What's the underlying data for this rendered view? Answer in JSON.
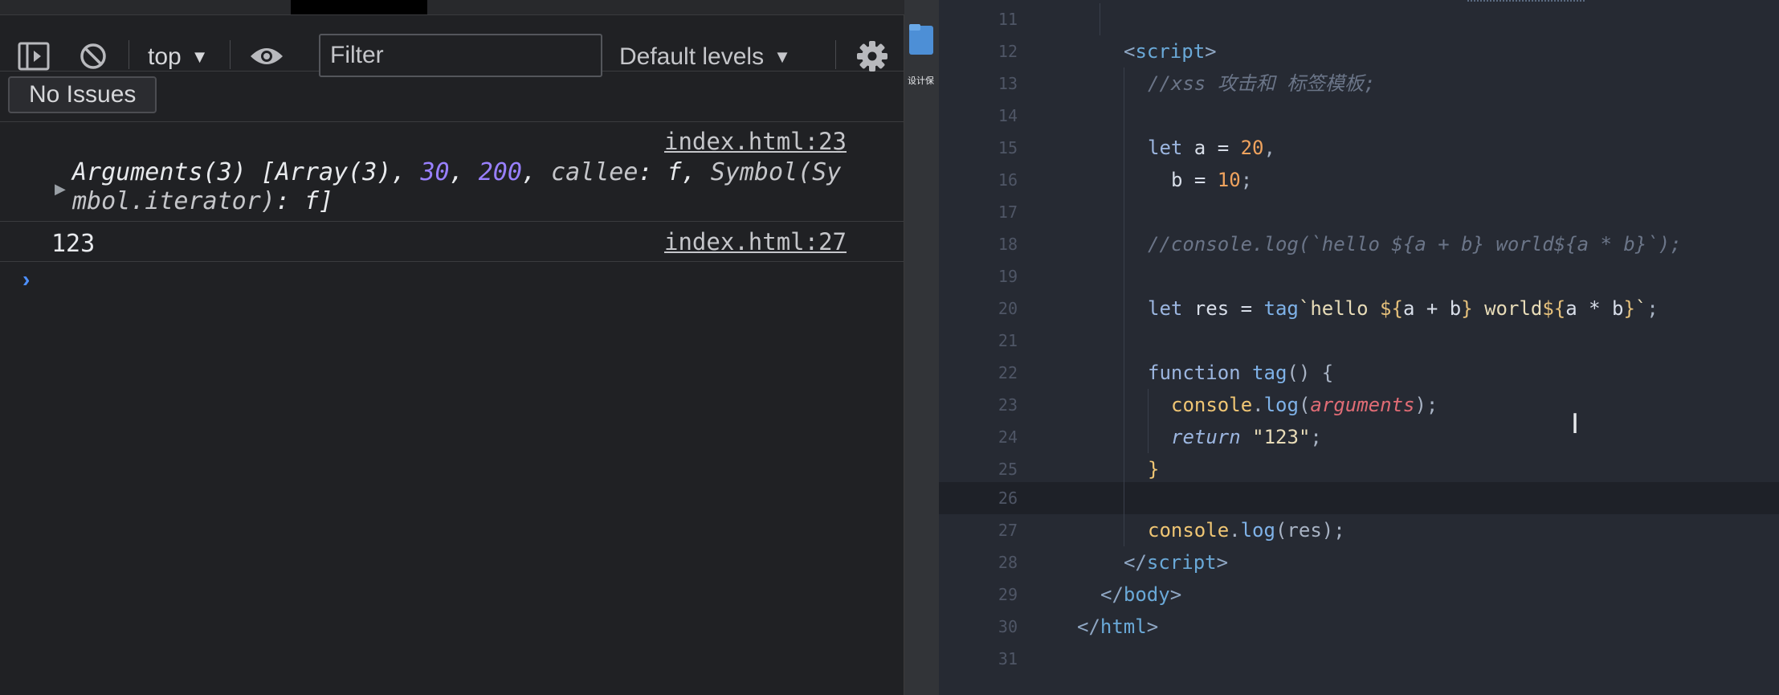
{
  "devtools": {
    "toolbar": {
      "context_value": "top",
      "filter_placeholder": "Filter",
      "levels_value": "Default levels"
    },
    "issues_label": "No Issues",
    "messages": [
      {
        "source": "index.html:23",
        "content": {
          "prefix": "Arguments(3) [Array(3), ",
          "n1": "30",
          "sep1": ", ",
          "n2": "200",
          "sep2": ", ",
          "callee": "callee",
          "rest1": ": f, ",
          "symbol": "Symbol(Sy",
          "line2_symbol": "mbol.iterator)",
          "line2_rest": ": f]"
        }
      },
      {
        "source": "index.html:27",
        "value": "123"
      }
    ]
  },
  "sidebar": {
    "folder_label": "设计保"
  },
  "editor": {
    "line_numbers": [
      "11",
      "12",
      "13",
      "14",
      "15",
      "16",
      "17",
      "18",
      "19",
      "20",
      "21",
      "22",
      "23",
      "24",
      "25",
      "26",
      "27",
      "28",
      "29",
      "30",
      "31"
    ],
    "l12": {
      "open": "<",
      "tag": "script",
      "close": ">"
    },
    "l13": "//xss 攻击和 标签模板;",
    "l15": {
      "kw": "let",
      "var": " a = ",
      "num": "20",
      "end": ","
    },
    "l16": {
      "var": "b = ",
      "num": "10",
      "end": ";"
    },
    "l18": "//console.log(`hello ${a + b} world${a * b}`);",
    "l20": {
      "kw": "let",
      "var": " res = ",
      "fn": "tag",
      "tpl1": "`hello ",
      "ex1o": "${",
      "ex1": "a + b",
      "ex1c": "}",
      "tpl2": " world",
      "ex2o": "${",
      "ex2": "a * b",
      "ex2c": "}",
      "tpl3": "`",
      "end": ";"
    },
    "l22": {
      "kw": "function",
      "fn": " tag",
      "rest": "() {"
    },
    "l23": {
      "obj": "console",
      "dot": ".",
      "meth": "log",
      "p1": "(",
      "args": "arguments",
      "p2": ");"
    },
    "l24": {
      "kw": "return",
      "str": " \"123\"",
      "end": ";"
    },
    "l25": "}",
    "l27": {
      "obj": "console",
      "dot": ".",
      "meth": "log",
      "rest": "(res);"
    },
    "l28": {
      "open": "</",
      "tag": "script",
      "close": ">"
    },
    "l29": {
      "open": "</",
      "tag": "body",
      "close": ">"
    },
    "l30": {
      "open": "</",
      "tag": "html",
      "close": ">"
    }
  },
  "colors": {
    "devtools_bg": "#202124",
    "editor_bg": "#262a33",
    "number": "#9980ff",
    "prompt": "#4d90fe"
  },
  "icons": [
    "sidebar-toggle-icon",
    "clear-console-icon",
    "eye-icon",
    "gear-icon",
    "folder-icon",
    "text-cursor-icon",
    "expand-arrow-icon",
    "prompt-caret-icon"
  ]
}
